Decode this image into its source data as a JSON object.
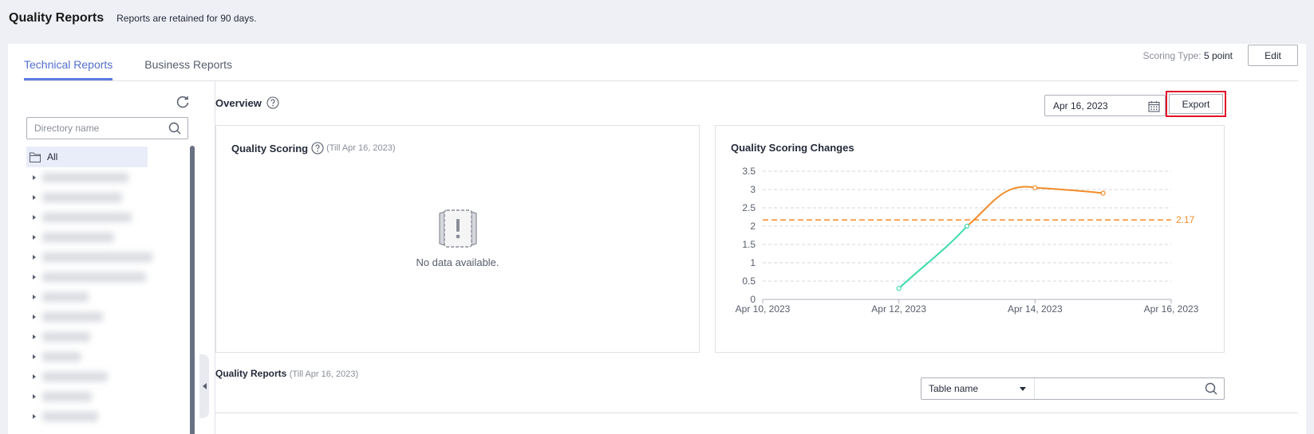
{
  "header": {
    "title": "Quality Reports",
    "retention_note": "Reports are retained for 90 days."
  },
  "tabs": [
    {
      "label": "Technical Reports",
      "active": true
    },
    {
      "label": "Business Reports",
      "active": false
    }
  ],
  "scoring": {
    "label": "Scoring Type:",
    "value": "5 point",
    "edit_label": "Edit"
  },
  "directory": {
    "search_placeholder": "Directory name",
    "root_label": "All",
    "collapsed_node_count": 13
  },
  "overview": {
    "title": "Overview",
    "date_value": "Apr 16, 2023",
    "export_label": "Export"
  },
  "quality_scoring": {
    "title": "Quality Scoring",
    "subtitle": "(Till Apr 16, 2023)",
    "empty_text": "No data available."
  },
  "quality_reports": {
    "title": "Quality Reports",
    "subtitle": "(Till Apr 16, 2023)",
    "filter_select": "Table name",
    "filter_placeholder": ""
  },
  "chart_data": {
    "type": "line",
    "title": "Quality Scoring Changes",
    "xlabel": "",
    "ylabel": "",
    "x_ticks": [
      "Apr 10, 2023",
      "Apr 12, 2023",
      "Apr 14, 2023",
      "Apr 16, 2023"
    ],
    "y_ticks": [
      0,
      0.5,
      1,
      1.5,
      2,
      2.5,
      3,
      3.5
    ],
    "ylim": [
      0,
      3.5
    ],
    "grid": true,
    "reference_line": {
      "value": 2.17,
      "label": "2.17",
      "color": "#f38b27"
    },
    "series": [
      {
        "color_below_ref": "#3ddbaa",
        "color_above_ref": "#f38b27",
        "points": [
          {
            "x": "Apr 12, 2023",
            "y": 0.3
          },
          {
            "x": "Apr 13, 2023",
            "y": 2.0
          },
          {
            "x": "Apr 14, 2023",
            "y": 3.05
          },
          {
            "x": "Apr 15, 2023",
            "y": 2.9
          }
        ]
      }
    ]
  },
  "colors": {
    "accent": "#5e7ce0",
    "active_tab_text": "#526ecc",
    "highlight_border": "#e0112a",
    "line_low": "#3ddbaa",
    "line_high": "#f38b27"
  }
}
